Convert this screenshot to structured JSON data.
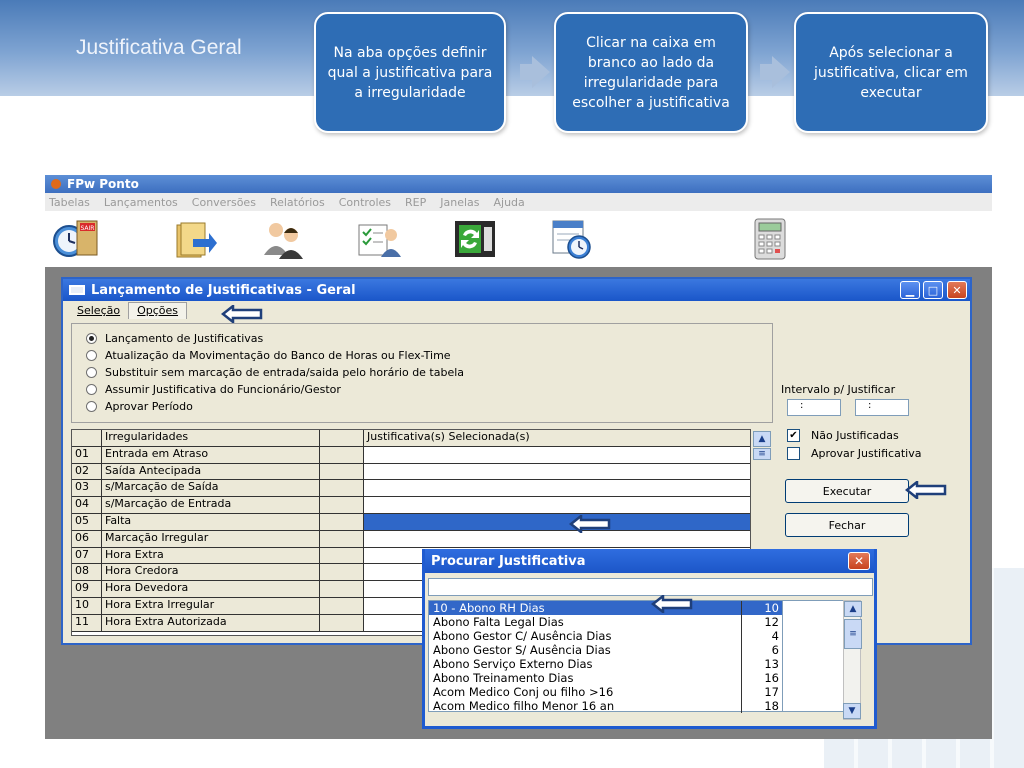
{
  "slide": {
    "title": "Justificativa Geral",
    "steps": [
      "Na aba opções definir qual a justificativa para a irregularidade",
      "Clicar na caixa em branco ao lado da irregularidade para escolher a justificativa",
      "Após selecionar a justificativa, clicar em executar"
    ]
  },
  "app": {
    "title": "FPw Ponto",
    "menu": [
      "Tabelas",
      "Lançamentos",
      "Conversões",
      "Relatórios",
      "Controles",
      "REP",
      "Janelas",
      "Ajuda"
    ],
    "toolbar_icons": [
      "exit-clock-icon",
      "folder-transfer-icon",
      "users-icon",
      "checklist-user-icon",
      "refresh-report-icon",
      "calendar-clock-icon",
      "calculator-icon"
    ],
    "toolbar_exit_label": "SAIR"
  },
  "dialog": {
    "title": "Lançamento de Justificativas - Geral",
    "tabs": [
      "Seleção",
      "Opções"
    ],
    "options": [
      {
        "label": "Lançamento de Justificativas",
        "selected": true
      },
      {
        "label": "Atualização da Movimentação do Banco de Horas ou Flex-Time",
        "selected": false
      },
      {
        "label": "Substituir sem marcação de entrada/saida pelo horário de tabela",
        "selected": false
      },
      {
        "label": "Assumir Justificativa do Funcionário/Gestor",
        "selected": false
      },
      {
        "label": "Aprovar Período",
        "selected": false
      }
    ],
    "grid": {
      "headers": [
        "Irregularidades",
        "Justificativa(s) Selecionada(s)"
      ],
      "rows": [
        [
          "01",
          "Entrada em Atraso"
        ],
        [
          "02",
          "Saída Antecipada"
        ],
        [
          "03",
          "s/Marcação de Saída"
        ],
        [
          "04",
          "s/Marcação de Entrada"
        ],
        [
          "05",
          "Falta"
        ],
        [
          "06",
          "Marcação Irregular"
        ],
        [
          "07",
          "Hora Extra"
        ],
        [
          "08",
          "Hora Credora"
        ],
        [
          "09",
          "Hora Devedora"
        ],
        [
          "10",
          "Hora Extra Irregular"
        ],
        [
          "11",
          "Hora Extra Autorizada"
        ]
      ],
      "selected_row": 4
    },
    "interval_label": "Intervalo p/ Justificar",
    "interval_from": ":",
    "interval_to": ":",
    "chk_nao_justificadas": "Não Justificadas",
    "chk_aprovar": "Aprovar Justificativa",
    "btn_executar": "Executar",
    "btn_fechar": "Fechar"
  },
  "popup": {
    "title": "Procurar Justificativa",
    "input_value": "",
    "items": [
      [
        "10 - Abono RH Dias",
        "10"
      ],
      [
        "Abono Falta Legal Dias",
        "12"
      ],
      [
        "Abono Gestor C/ Ausência Dias",
        "4"
      ],
      [
        "Abono Gestor S/ Ausência Dias",
        "6"
      ],
      [
        "Abono Serviço Externo Dias",
        "13"
      ],
      [
        "Abono Treinamento Dias",
        "16"
      ],
      [
        "Acom Medico Conj ou filho >16",
        "17"
      ],
      [
        "Acom Medico filho Menor 16 an",
        "18"
      ]
    ],
    "selected_index": 0
  },
  "colors": {
    "accent": "#2e6db5",
    "selection": "#3267c8",
    "arrow": "#1f3f7a"
  }
}
